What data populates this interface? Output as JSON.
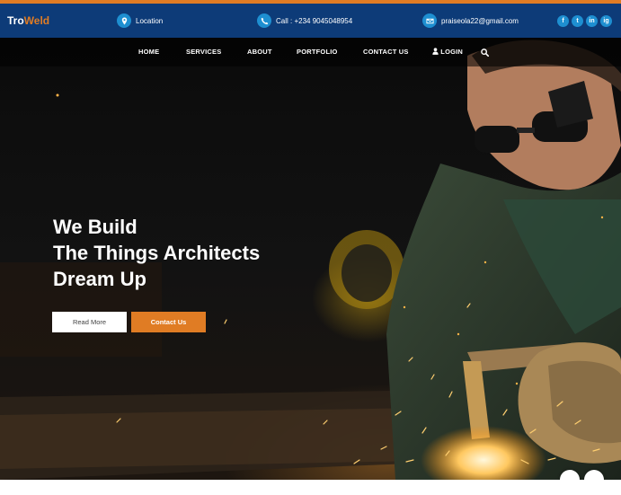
{
  "brand": {
    "part1": "Tro",
    "part2": "Weld"
  },
  "topbar": {
    "location": "Location",
    "phone": "Call : +234 9045048954",
    "email": "praiseola22@gmail.com",
    "socials": [
      "f",
      "t",
      "in",
      "ig"
    ]
  },
  "nav": {
    "home": "HOME",
    "services": "SERVICES",
    "about": "ABOUT",
    "portfolio": "PORTFOLIO",
    "contact": "CONTACT US",
    "login": "LOGIN"
  },
  "hero": {
    "line1": "We Build",
    "line2": "The Things Architects",
    "line3": "Dream Up",
    "read_more": "Read More",
    "contact_us": "Contact Us"
  },
  "slider": {
    "prev": "←",
    "next": "→"
  },
  "colors": {
    "brand_blue": "#0d3b78",
    "accent_orange": "#e07c24",
    "icon_blue": "#1e8fd1"
  }
}
